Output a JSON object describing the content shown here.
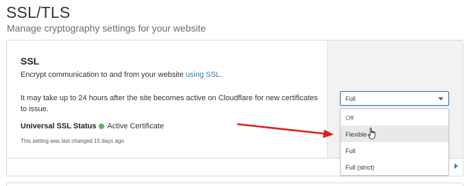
{
  "header": {
    "title": "SSL/TLS",
    "subtitle": "Manage cryptography settings for your website"
  },
  "ssl_card": {
    "heading": "SSL",
    "description_prefix": "Encrypt communication to and from your website ",
    "description_link": "using SSL",
    "description_suffix": ".",
    "note": "It may take up to 24 hours after the site becomes active on Cloudflare for new certificates to issue.",
    "status_label": "Universal SSL Status",
    "status_value": "Active Certificate",
    "last_changed": "This setting was last changed 15 days ago"
  },
  "ssl_select": {
    "selected": "Full",
    "options": [
      "Off",
      "Flexible",
      "Full",
      "Full (strict)"
    ],
    "hovered_option": "Flexible"
  },
  "colors": {
    "link": "#2c7cb0",
    "status_active": "#5eb35e",
    "annotation_arrow": "#e01b1b"
  },
  "icons": {
    "status": "green-dot-icon",
    "caret": "chevron-down-icon",
    "cursor": "hand-pointer-icon",
    "footer": "chevron-right-icon"
  }
}
